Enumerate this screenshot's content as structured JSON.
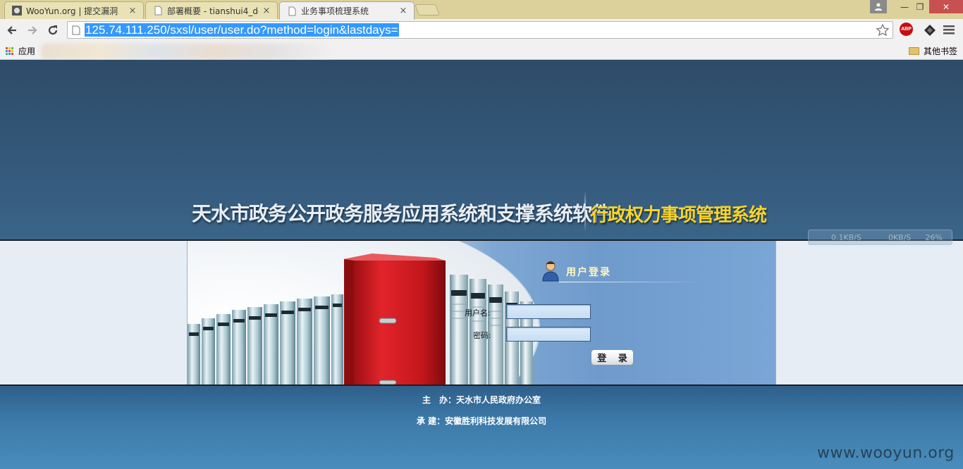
{
  "browser": {
    "tabs": [
      {
        "title": "WooYun.org | 提交漏洞",
        "close": "×",
        "active": false
      },
      {
        "title": "部署概要 - tianshui4_do",
        "close": "×",
        "active": false
      },
      {
        "title": "业务事项梳理系统",
        "close": "×",
        "active": true
      }
    ],
    "window_controls": {
      "minimize": "—",
      "maximize": "❐",
      "close": "✕"
    },
    "url": "125.74.111.250/sxsl/user/user.do?method=login&lastdays=",
    "extensions": {
      "abp": "ABP"
    },
    "bookmarks": {
      "apps_label": "应用",
      "other_label": "其他书签"
    }
  },
  "speed_widget": {
    "down": "0.1KB/S",
    "up": "0KB/S",
    "percent": "26%"
  },
  "header": {
    "title": "天水市政务公开政务服务应用系统和支撑系统软件",
    "subtitle": "行政权力事项管理系统"
  },
  "login": {
    "title": "用户登录",
    "username_label": "用户名:",
    "password_label": "密码:",
    "username_value": "",
    "password_value": "",
    "submit_label": "登 录"
  },
  "footer": {
    "host": "主　办：天水市人民政府办公室",
    "builder": "承  建：安徽胜利科技发展有限公司",
    "watermark": "www.wooyun.org"
  },
  "colors": {
    "tabstrip": "#dcd19a",
    "header_bg": "#2e4c69",
    "subtitle": "#f7d52a",
    "footer_bg": "#4a8dbd",
    "url_highlight": "#3399ff"
  }
}
